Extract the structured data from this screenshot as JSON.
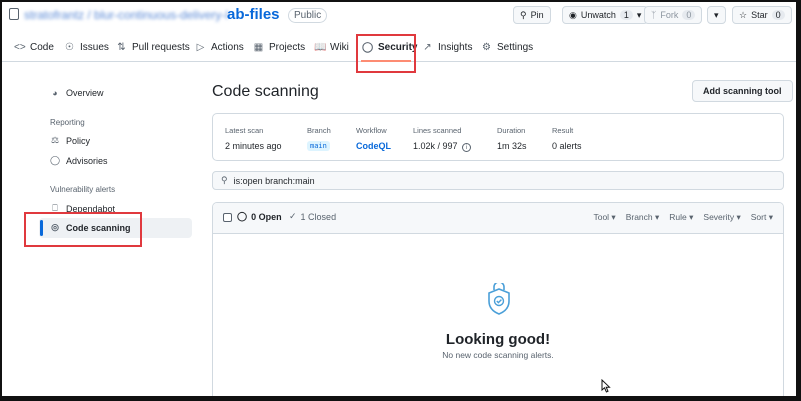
{
  "header": {
    "owner_blurred": "stratofrantz / blur-continuous-delivery-l",
    "repo_name": "ab-files",
    "visibility": "Public",
    "pin_label": "Pin",
    "watch_label": "Unwatch",
    "watch_count": "1",
    "fork_label": "Fork",
    "fork_count": "0",
    "star_label": "Star",
    "star_count": "0"
  },
  "tabs": [
    {
      "label": "Code",
      "icon": "code-icon"
    },
    {
      "label": "Issues",
      "icon": "issue-icon"
    },
    {
      "label": "Pull requests",
      "icon": "pull-request-icon"
    },
    {
      "label": "Actions",
      "icon": "play-icon"
    },
    {
      "label": "Projects",
      "icon": "table-icon"
    },
    {
      "label": "Wiki",
      "icon": "book-icon"
    },
    {
      "label": "Security",
      "icon": "shield-icon",
      "active": true
    },
    {
      "label": "Insights",
      "icon": "graph-icon"
    },
    {
      "label": "Settings",
      "icon": "gear-icon"
    }
  ],
  "sidebar": {
    "overview": "Overview",
    "reporting_heading": "Reporting",
    "policy": "Policy",
    "advisories": "Advisories",
    "vuln_heading": "Vulnerability alerts",
    "dependabot": "Dependabot",
    "code_scanning": "Code scanning"
  },
  "main": {
    "title": "Code scanning",
    "add_tool_label": "Add scanning tool",
    "scan": {
      "latest_scan_label": "Latest scan",
      "latest_scan_value": "2 minutes ago",
      "branch_label": "Branch",
      "branch_value": "main",
      "workflow_label": "Workflow",
      "workflow_value": "CodeQL",
      "lines_label": "Lines scanned",
      "lines_value": "1.02k / 997",
      "duration_label": "Duration",
      "duration_value": "1m 32s",
      "result_label": "Result",
      "result_value": "0 alerts"
    },
    "search_value": "is:open branch:main",
    "results": {
      "open_label": "0 Open",
      "closed_label": "1 Closed",
      "filters": [
        "Tool",
        "Branch",
        "Rule",
        "Severity",
        "Sort"
      ],
      "empty_title": "Looking good!",
      "empty_subtitle": "No new code scanning alerts."
    }
  },
  "colors": {
    "accent": "#0969da",
    "highlight": "#e0393e",
    "active_underline": "#fd8c73"
  }
}
